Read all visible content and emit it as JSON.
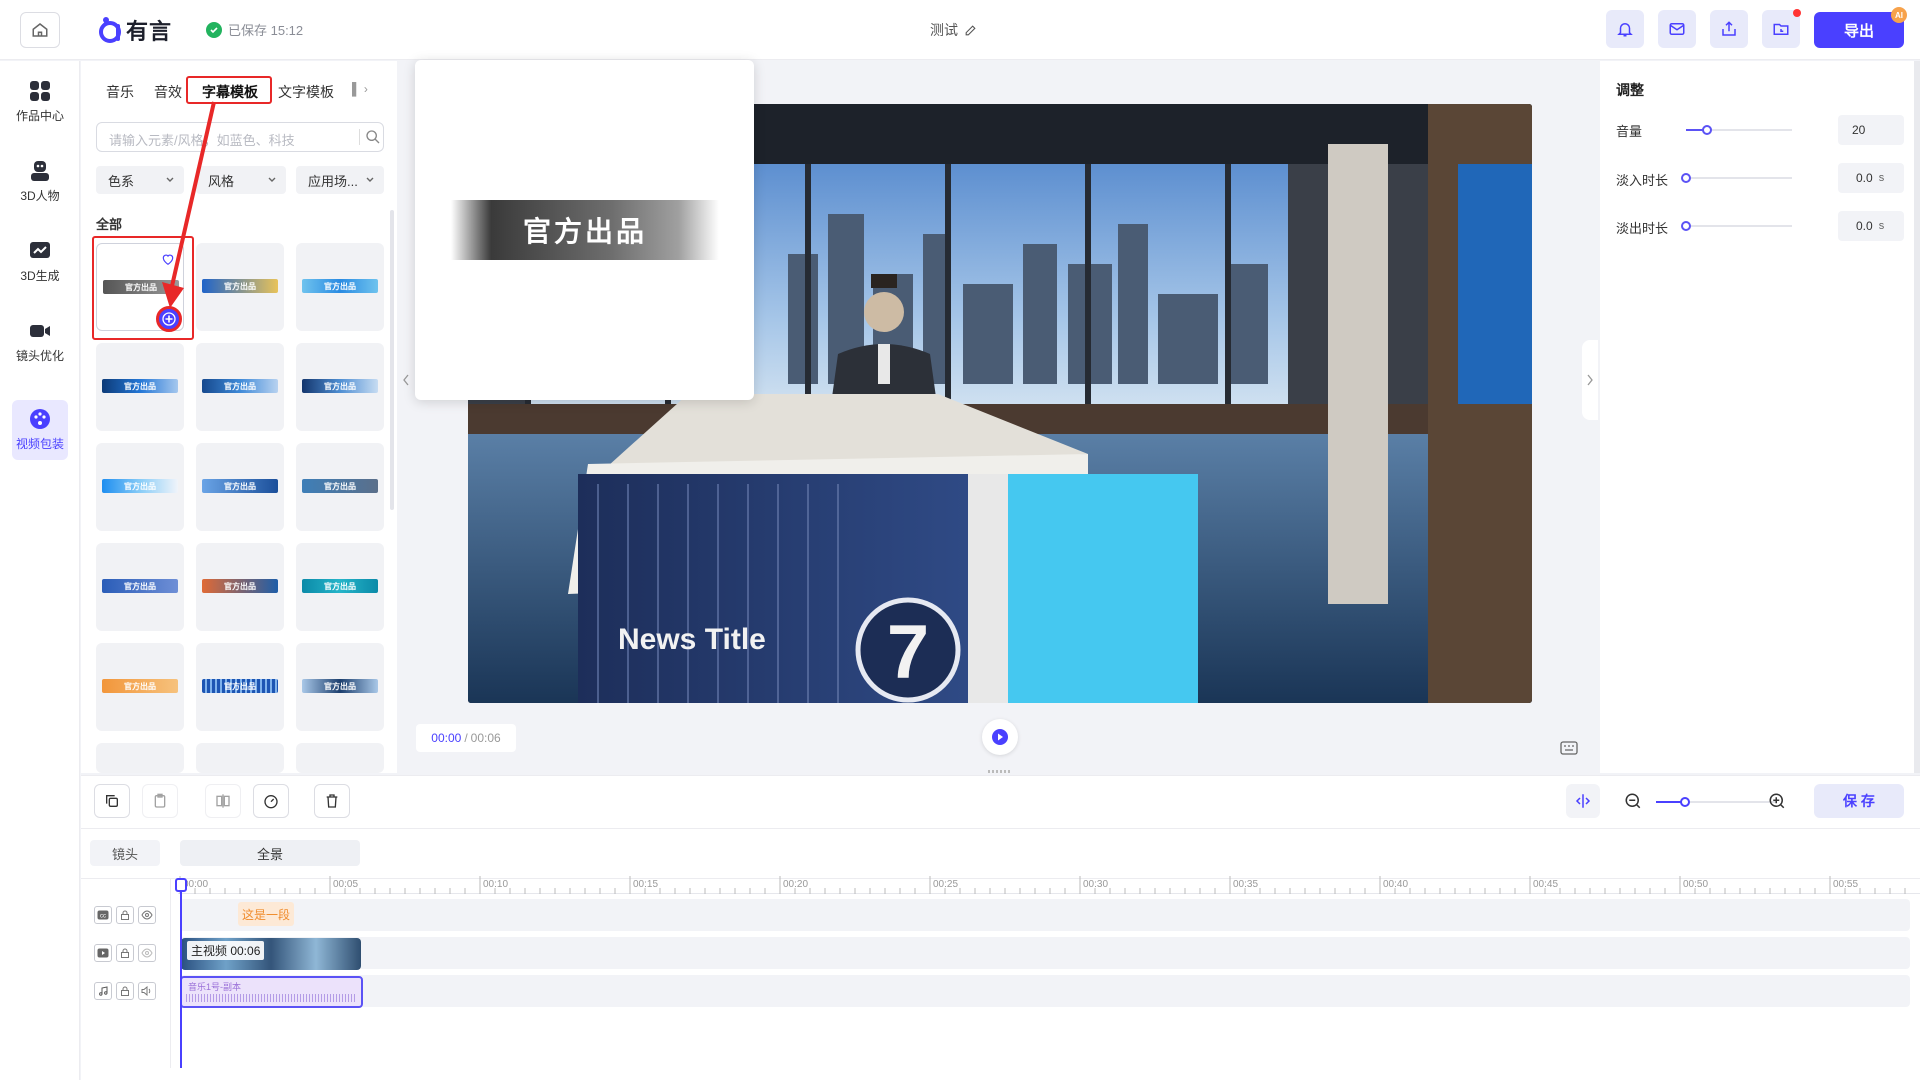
{
  "app": {
    "logo_text": "有言",
    "save_status": "已保存 15:12",
    "doc_title": "测试",
    "export_label": "导出",
    "ai_badge": "AI"
  },
  "leftnav": [
    {
      "label": "作品中心",
      "icon": "grid-icon"
    },
    {
      "label": "3D人物",
      "icon": "avatar-icon"
    },
    {
      "label": "3D生成",
      "icon": "chart-icon"
    },
    {
      "label": "镜头优化",
      "icon": "camera-icon"
    },
    {
      "label": "视频包装",
      "icon": "palette-icon",
      "active": true
    }
  ],
  "asset_panel": {
    "tabs": [
      "音乐",
      "音效",
      "字幕模板",
      "文字模板"
    ],
    "active_tab": "字幕模板",
    "search_placeholder": "请输入元素/风格，如蓝色、科技",
    "filters": [
      "色系",
      "风格",
      "应用场..."
    ],
    "section_label": "全部",
    "tile_label": "官方出品",
    "tile_count": 15
  },
  "preview_popup": {
    "banner_text": "官方出品"
  },
  "video": {
    "desk_text": "News Title",
    "desk_number": "7",
    "time_current": "00:00",
    "time_total": "00:06"
  },
  "right_panel": {
    "title": "调整",
    "rows": [
      {
        "label": "音量",
        "value": "20",
        "fraction": 0.2
      },
      {
        "label": "淡入时长",
        "value": "0.0",
        "unit": "s",
        "fraction": 0.0
      },
      {
        "label": "淡出时长",
        "value": "0.0",
        "unit": "s",
        "fraction": 0.0
      }
    ]
  },
  "timeline": {
    "save_label": "保 存",
    "tab_shot": "镜头",
    "tab_full": "全景",
    "ticks": [
      "00:00",
      "00:05",
      "00:10",
      "00:15",
      "00:20",
      "00:25",
      "00:30",
      "00:35",
      "00:40",
      "00:45",
      "00:50",
      "00:55"
    ],
    "text_clip": "这是一段",
    "video_clip": "主视频 00:06",
    "audio_clip": "音乐1号-副本"
  },
  "colors": {
    "accent": "#4a40ff",
    "annotation_red": "#e82828"
  }
}
